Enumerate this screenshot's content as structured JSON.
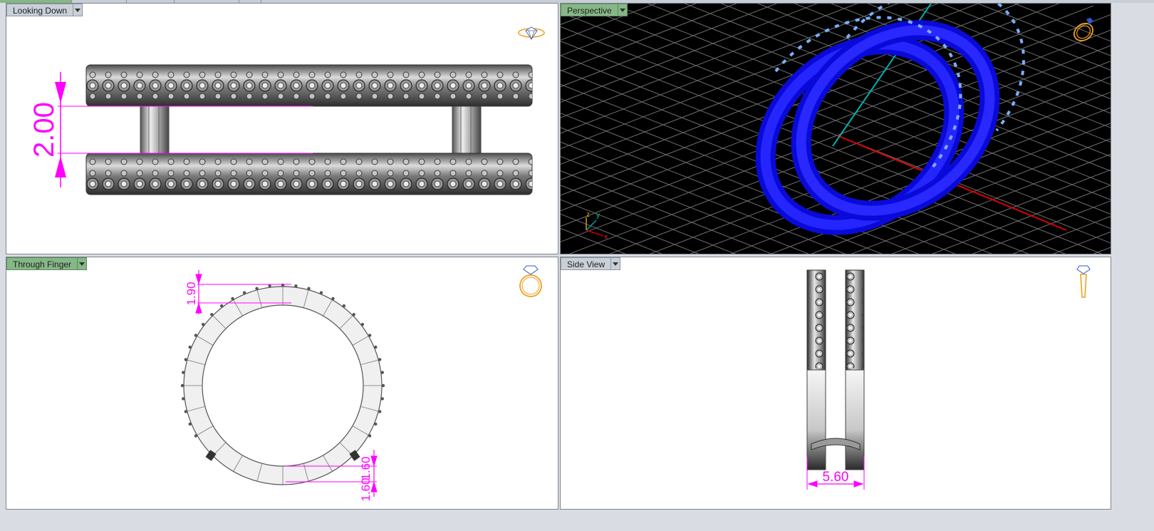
{
  "viewports": {
    "top_left": {
      "label": "Looking Down",
      "active": false,
      "dimension": "2.00"
    },
    "top_right": {
      "label": "Perspective",
      "active": true,
      "axis_labels": {
        "z": "z",
        "y": "y",
        "x": "x"
      }
    },
    "bottom_left": {
      "label": "Through Finger",
      "active": true,
      "dimensions": [
        "1.90",
        "1.60"
      ]
    },
    "bottom_right": {
      "label": "Side View",
      "active": false,
      "dimension": "5.60"
    }
  },
  "colors": {
    "dimension": "#ff00ff",
    "model_shaded": "#1010ee",
    "grid_bg": "#000000",
    "x_axis": "#cc0000",
    "y_axis": "#00a0a0",
    "active_label": "#86b787",
    "icon_orange": "#f0a020"
  },
  "icons": {
    "top_left": "ring-top-view-icon",
    "top_right": "ring-perspective-icon",
    "bottom_left": "ring-front-view-icon",
    "bottom_right": "ring-side-view-icon"
  }
}
